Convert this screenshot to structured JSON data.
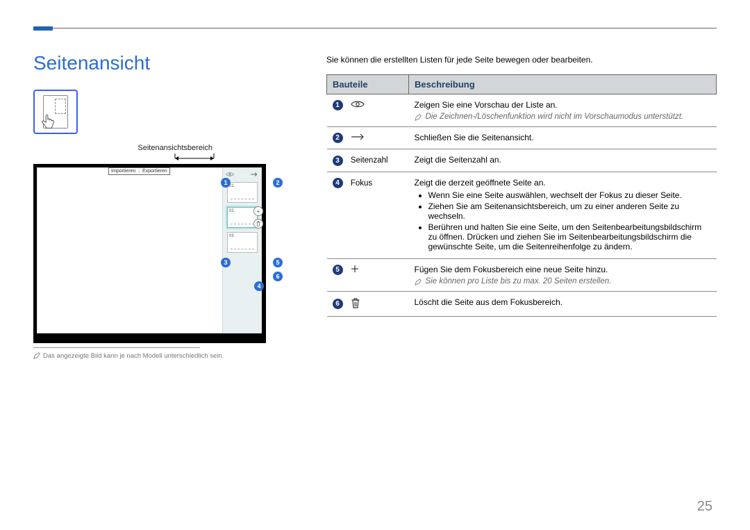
{
  "page": {
    "title": "Seitenansicht",
    "number": "25"
  },
  "left": {
    "panel_caption": "Seitenansichtsbereich",
    "toolbar": {
      "import": "Importieren",
      "export": "Exportieren"
    },
    "thumbs": {
      "p1": "01",
      "p2": "02",
      "p3": "03"
    },
    "image_note": "Das angezeigte Bild kann je nach Modell unterschiedlich sein."
  },
  "intro": "Sie können die erstellten Listen für jede Seite bewegen oder bearbeiten.",
  "table": {
    "header_parts": "Bauteile",
    "header_desc": "Beschreibung",
    "rows": [
      {
        "num": "1",
        "part_text": "",
        "icon": "eye",
        "desc": "Zeigen Sie eine Vorschau der Liste an.",
        "note": "Die Zeichnen-/Löschenfunktion wird nicht im Vorschaumodus unterstützt."
      },
      {
        "num": "2",
        "part_text": "",
        "icon": "arrow",
        "desc": "Schließen Sie die Seitenansicht."
      },
      {
        "num": "3",
        "part_text": "Seitenzahl",
        "desc": "Zeigt die Seitenzahl an."
      },
      {
        "num": "4",
        "part_text": "Fokus",
        "desc_intro": "Zeigt die derzeit geöffnete Seite an.",
        "bullets": [
          "Wenn Sie eine Seite auswählen, wechselt der Fokus zu dieser Seite.",
          "Ziehen Sie am Seitenansichtsbereich, um zu einer anderen Seite zu wechseln.",
          "Berühren und halten Sie eine Seite, um den Seitenbearbeitungsbildschirm zu öffnen. Drücken und ziehen Sie im Seitenbearbeitungsbildschirm die gewünschte Seite, um die Seitenreihenfolge zu ändern."
        ]
      },
      {
        "num": "5",
        "part_text": "",
        "icon": "plus",
        "desc": "Fügen Sie dem Fokusbereich eine neue Seite hinzu.",
        "note": "Sie können pro Liste bis zu max. 20 Seiten erstellen."
      },
      {
        "num": "6",
        "part_text": "",
        "icon": "trash",
        "desc": "Löscht die Seite aus dem Fokusbereich."
      }
    ]
  }
}
